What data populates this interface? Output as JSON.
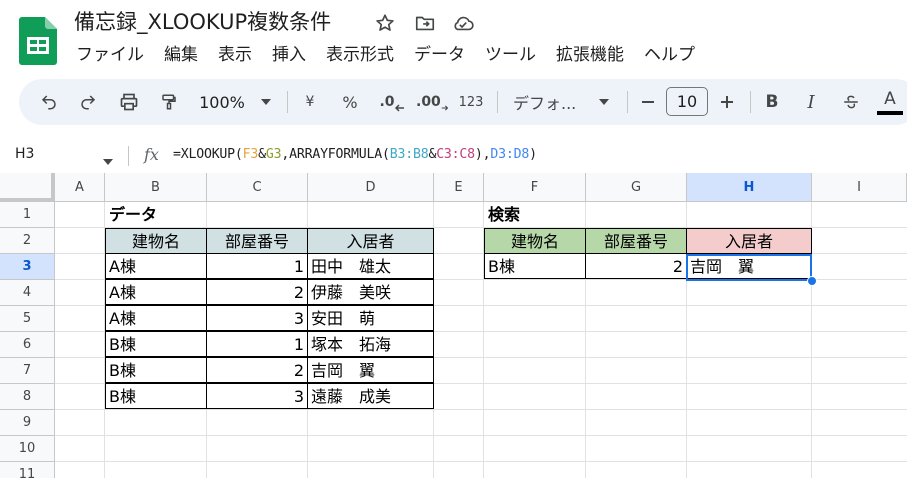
{
  "app": {
    "document_title": "備忘録_XLOOKUP複数条件"
  },
  "menu": [
    "ファイル",
    "編集",
    "表示",
    "挿入",
    "表示形式",
    "データ",
    "ツール",
    "拡張機能",
    "ヘルプ"
  ],
  "toolbar": {
    "zoom": "100%",
    "currency": "¥",
    "percent": "%",
    "decrease_decimal": ".0",
    "increase_decimal": ".00",
    "number_format": "123",
    "font_family": "デフォ...",
    "font_size": "10",
    "bold": "B",
    "italic": "I",
    "text_color": "A"
  },
  "formula_bar": {
    "name_box": "H3",
    "fx": "fx",
    "formula_parts": [
      {
        "text": "=XLOOKUP(",
        "color": "#1f1f1f"
      },
      {
        "text": "F3",
        "color": "#e8a33d"
      },
      {
        "text": "&",
        "color": "#1f1f1f"
      },
      {
        "text": "G3",
        "color": "#8d9c2d"
      },
      {
        "text": ",ARRAYFORMULA(",
        "color": "#1f1f1f"
      },
      {
        "text": "B3:B8",
        "color": "#3fa9c4"
      },
      {
        "text": "&",
        "color": "#1f1f1f"
      },
      {
        "text": "C3:C8",
        "color": "#c2417c"
      },
      {
        "text": "),",
        "color": "#1f1f1f"
      },
      {
        "text": "D3:D8",
        "color": "#4285f4"
      },
      {
        "text": ")",
        "color": "#1f1f1f"
      }
    ]
  },
  "sheet": {
    "columns": [
      "A",
      "B",
      "C",
      "D",
      "E",
      "F",
      "G",
      "H",
      "I"
    ],
    "rows": [
      "1",
      "2",
      "3",
      "4",
      "5",
      "6",
      "7",
      "8",
      "9",
      "10",
      "11"
    ],
    "active_cell": "H3",
    "data_section": {
      "label": "データ",
      "headers": [
        "建物名",
        "部屋番号",
        "入居者"
      ],
      "rows": [
        [
          "A棟",
          "1",
          "田中　雄太"
        ],
        [
          "A棟",
          "2",
          "伊藤　美咲"
        ],
        [
          "A棟",
          "3",
          "安田　萌"
        ],
        [
          "B棟",
          "1",
          "塚本　拓海"
        ],
        [
          "B棟",
          "2",
          "吉岡　翼"
        ],
        [
          "B棟",
          "3",
          "遠藤　成美"
        ]
      ]
    },
    "search_section": {
      "label": "検索",
      "headers": [
        "建物名",
        "部屋番号",
        "入居者"
      ],
      "row": [
        "B棟",
        "2",
        "吉岡　翼"
      ]
    }
  },
  "colors": {
    "data_header_bg": "#d0e0e3",
    "search_header_building_bg": "#b6d7a8",
    "search_header_room_bg": "#b6d7a8",
    "search_header_resident_bg": "#f4cccc",
    "selection": "#1a73e8",
    "sheets_green": "#0f9d58"
  }
}
